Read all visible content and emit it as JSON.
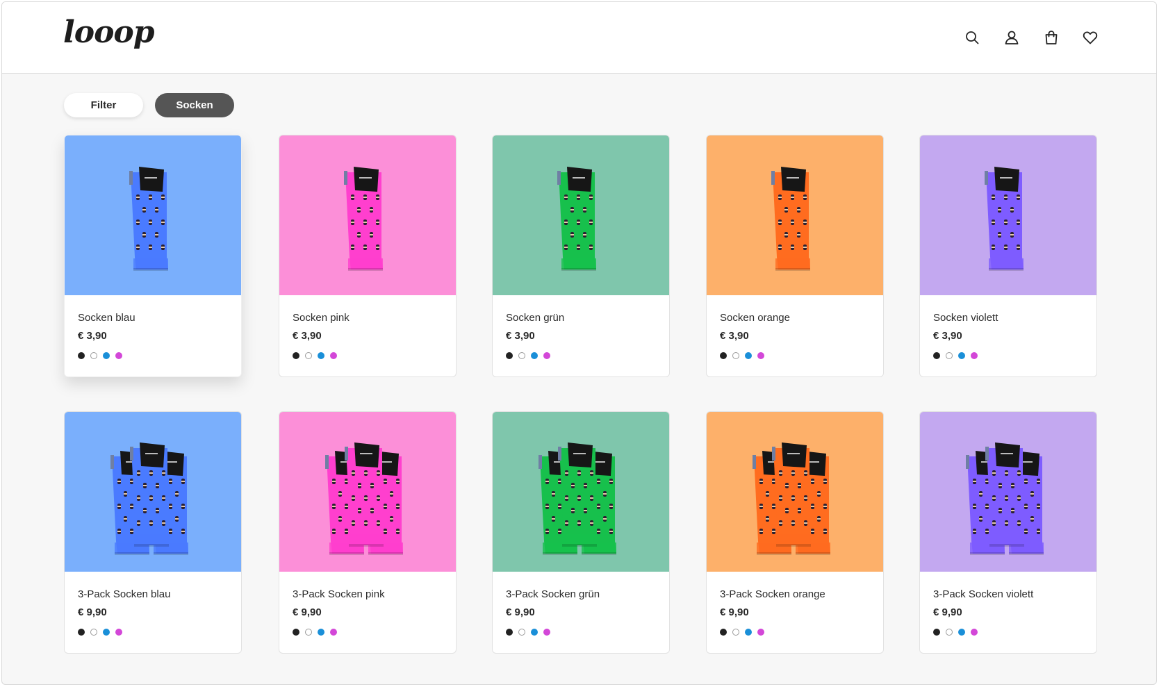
{
  "header": {
    "logo": "looop",
    "icons": [
      "search-icon",
      "user-icon",
      "bag-icon",
      "heart-icon"
    ]
  },
  "filters": {
    "filter_label": "Filter",
    "active_chip": "Socken"
  },
  "swatch_colors": [
    "#222222",
    "#ffffff",
    "#1a8fd8",
    "#d347d8"
  ],
  "products": [
    {
      "name": "Socken blau",
      "price": "€ 3,90",
      "bg": "#7aaffc",
      "sock": "#4a7bff",
      "pack": false
    },
    {
      "name": "Socken pink",
      "price": "€ 3,90",
      "bg": "#fc8fd8",
      "sock": "#ff3fce",
      "pack": false
    },
    {
      "name": "Socken grün",
      "price": "€ 3,90",
      "bg": "#7fc6ac",
      "sock": "#17c04c",
      "pack": false
    },
    {
      "name": "Socken orange",
      "price": "€ 3,90",
      "bg": "#fdb06a",
      "sock": "#ff6c1f",
      "pack": false
    },
    {
      "name": "Socken violett",
      "price": "€ 3,90",
      "bg": "#c3a8f0",
      "sock": "#7e5cff",
      "pack": false
    },
    {
      "name": "3-Pack Socken blau",
      "price": "€ 9,90",
      "bg": "#7aaffc",
      "sock": "#4a7bff",
      "pack": true
    },
    {
      "name": "3-Pack Socken pink",
      "price": "€ 9,90",
      "bg": "#fc8fd8",
      "sock": "#ff3fce",
      "pack": true
    },
    {
      "name": "3-Pack Socken grün",
      "price": "€ 9,90",
      "bg": "#7fc6ac",
      "sock": "#17c04c",
      "pack": true
    },
    {
      "name": "3-Pack Socken orange",
      "price": "€ 9,90",
      "bg": "#fdb06a",
      "sock": "#ff6c1f",
      "pack": true
    },
    {
      "name": "3-Pack Socken violett",
      "price": "€ 9,90",
      "bg": "#c3a8f0",
      "sock": "#7e5cff",
      "pack": true
    }
  ]
}
